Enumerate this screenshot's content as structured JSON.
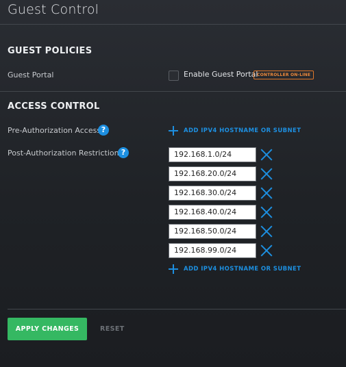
{
  "page": {
    "title": "Guest Control"
  },
  "guest_policies": {
    "heading": "GUEST POLICIES",
    "guest_portal_label": "Guest Portal",
    "enable_label": "Enable Guest Portal",
    "enabled": false,
    "badge": "CONTROLLER ON-LINE",
    "badge_color": "#e0782a"
  },
  "access_control": {
    "heading": "ACCESS CONTROL",
    "pre_auth_label": "Pre-Authorization Access",
    "post_auth_label": "Post-Authorization Restrictions",
    "add_label": "ADD IPV4 HOSTNAME OR SUBNET",
    "help_glyph": "?",
    "subnets": [
      "192.168.1.0/24",
      "192.168.20.0/24",
      "192.168.30.0/24",
      "192.168.40.0/24",
      "192.168.50.0/24",
      "192.168.99.0/24"
    ]
  },
  "actions": {
    "apply_label": "APPLY CHANGES",
    "reset_label": "RESET"
  },
  "colors": {
    "accent": "#1d8fe0",
    "apply": "#35b862"
  },
  "icons": {
    "help": "question-circle-icon",
    "add": "plus-icon",
    "remove": "close-x-icon"
  }
}
